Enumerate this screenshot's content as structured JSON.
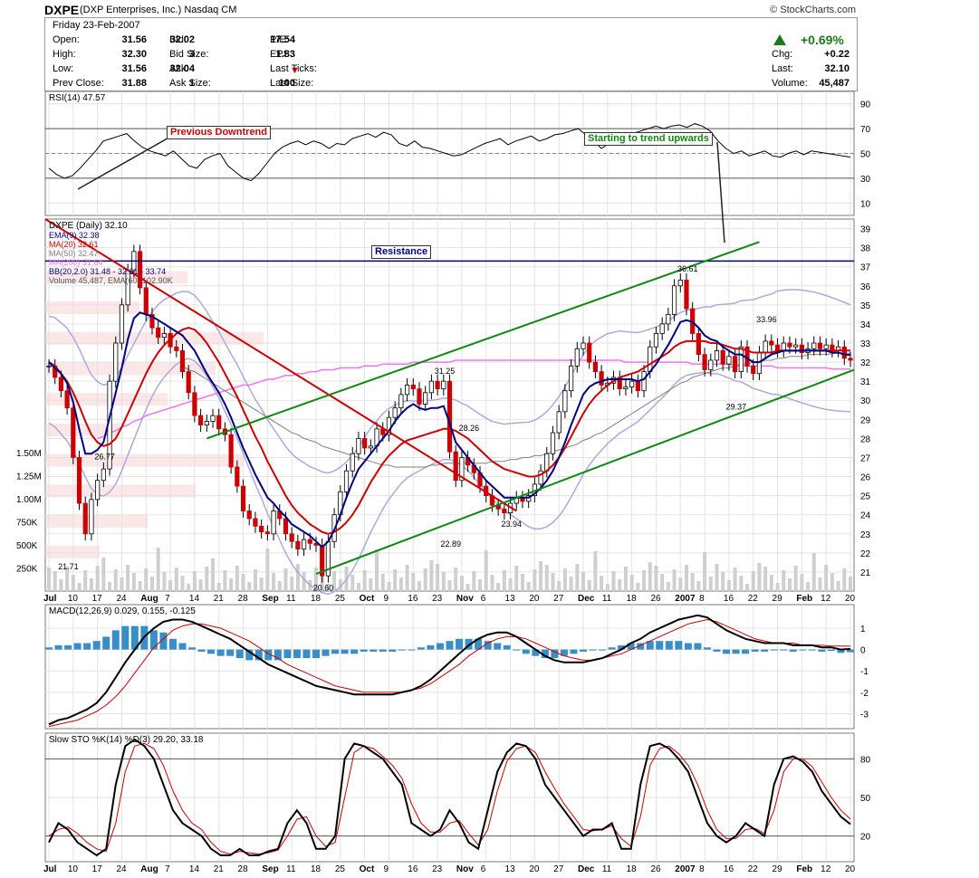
{
  "header": {
    "symbol": "DXPE",
    "company": "(DXP Enterprises, Inc.)  Nasdaq CM",
    "source": "© StockCharts.com"
  },
  "quote": {
    "date": "Friday   23-Feb-2007",
    "rows": [
      [
        "Open:",
        "31.56",
        "Bid:",
        "32.02",
        "P/E:",
        "17.54"
      ],
      [
        "High:",
        "32.30",
        "Bid Size:",
        "3",
        "EPS:",
        "1.83"
      ],
      [
        "Low:",
        "31.56",
        "Ask:",
        "32.04",
        "Last Ticks:",
        ""
      ],
      [
        "Prev Close:",
        "31.88",
        "Ask Size:",
        "1",
        "Last Size:",
        "100"
      ]
    ],
    "pct": "+0.69%",
    "right": [
      [
        "Chg:",
        "+0.22"
      ],
      [
        "Last:",
        "32.10"
      ],
      [
        "Volume:",
        "45,487"
      ]
    ]
  },
  "annotations": {
    "prev_down": "Previous Downtrend",
    "trend_up": "Starting to trend upwards",
    "resistance": "Resistance"
  },
  "colors": {
    "up": "#ffffff",
    "down": "#cc0000",
    "ema9": "#000080",
    "ma20": "#cc0000",
    "ma50": "#808080",
    "ma200": "#ee77ee",
    "bb": "#aaaadd",
    "green": "#118811",
    "resistance": "#000080",
    "volume": "#cfcfcf",
    "macd_hist": "#3a8ec8"
  },
  "chart_data": [
    {
      "type": "line",
      "title": "RSI(14) 47.57",
      "ylim": [
        0,
        100
      ],
      "yticks": [
        10,
        30,
        50,
        70,
        90
      ],
      "series": [
        {
          "values": [
            38,
            33,
            30,
            32,
            38,
            45,
            52,
            60,
            62,
            64,
            66,
            60,
            55,
            52,
            50,
            48,
            52,
            46,
            40,
            38,
            45,
            48,
            50,
            40,
            35,
            30,
            28,
            34,
            42,
            50,
            55,
            58,
            60,
            57,
            60,
            58,
            54,
            58,
            57,
            62,
            64,
            66,
            63,
            67,
            65,
            58,
            56,
            60,
            55,
            54,
            52,
            50,
            48,
            49,
            52,
            55,
            58,
            60,
            62,
            57,
            60,
            62,
            64,
            60,
            62,
            65,
            66,
            68,
            70,
            65,
            60,
            54,
            58,
            62,
            63,
            66,
            68,
            70,
            72,
            70,
            72,
            73,
            71,
            74,
            72,
            68,
            60,
            54,
            50,
            52,
            48,
            50,
            52,
            48,
            47,
            50,
            52,
            49,
            52,
            51,
            50,
            49,
            48,
            47
          ]
        }
      ]
    },
    {
      "type": "candlestick",
      "title": "DXPE (Daily) 32.10",
      "legend": [
        "EMA(9) 32.38",
        "MA(20) 32.61",
        "MA(50) 32.47",
        "MA(200) 31.64",
        "BB(20,2.0) 31.48 - 32.61 - 33.74",
        "Volume 45,487, EMA(60) 102.90K"
      ],
      "ylim": [
        20,
        39.5
      ],
      "yticks": [
        21,
        22,
        23,
        24,
        25,
        26,
        27,
        28,
        29,
        30,
        31,
        32,
        33,
        34,
        35,
        36,
        37,
        38,
        39
      ],
      "x_ticks": [
        "Jul",
        "10",
        "17",
        "24",
        "Aug",
        "7",
        "14",
        "21",
        "28",
        "Sep",
        "11",
        "18",
        "25",
        "Oct",
        "9",
        "16",
        "23",
        "Nov",
        "6",
        "13",
        "20",
        "27",
        "Dec",
        "11",
        "18",
        "26",
        "2007",
        "8",
        "16",
        "22",
        "29",
        "Feb",
        "12",
        "20"
      ],
      "resistance": 37.3,
      "volume_ticks": [
        "250K",
        "500K",
        "750K",
        "1.00M",
        "1.25M",
        "1.50M"
      ],
      "labels": [
        {
          "idx": 3,
          "v": 21.71,
          "text": "21.71"
        },
        {
          "idx": 9,
          "v": 26.77,
          "text": "26.77"
        },
        {
          "idx": 45,
          "v": 20.6,
          "text": "20.60"
        },
        {
          "idx": 65,
          "v": 31.25,
          "text": "31.25"
        },
        {
          "idx": 66,
          "v": 22.89,
          "text": "22.89"
        },
        {
          "idx": 69,
          "v": 28.26,
          "text": "28.26"
        },
        {
          "idx": 76,
          "v": 23.94,
          "text": "23.94"
        },
        {
          "idx": 105,
          "v": 36.61,
          "text": "36.61"
        },
        {
          "idx": 113,
          "v": 29.37,
          "text": "29.37"
        },
        {
          "idx": 118,
          "v": 33.96,
          "text": "33.96"
        }
      ],
      "close": [
        31.8,
        31.2,
        30.5,
        29.6,
        27.0,
        24.6,
        23.0,
        24.8,
        25.8,
        26.4,
        31.0,
        33.0,
        35.0,
        36.8,
        37.8,
        35.9,
        34.5,
        33.8,
        33.3,
        33.5,
        32.8,
        32.6,
        31.5,
        30.4,
        29.2,
        28.7,
        28.9,
        29.2,
        28.5,
        28.2,
        26.5,
        25.5,
        24.2,
        23.8,
        23.4,
        23.1,
        23.0,
        24.2,
        23.8,
        23.0,
        22.6,
        22.2,
        22.7,
        22.5,
        22.4,
        20.8,
        22.6,
        24.0,
        25.2,
        26.3,
        27.2,
        28.0,
        27.5,
        27.6,
        28.5,
        28.2,
        29.1,
        29.6,
        30.3,
        30.8,
        30.6,
        29.8,
        30.4,
        31.0,
        30.6,
        31.0,
        27.3,
        25.8,
        27.0,
        26.6,
        26.2,
        25.5,
        25.0,
        24.5,
        24.3,
        24.1,
        24.6,
        24.9,
        24.7,
        25.0,
        25.6,
        26.3,
        27.2,
        28.3,
        29.4,
        30.5,
        31.8,
        32.7,
        33.0,
        32.0,
        31.5,
        30.8,
        30.9,
        31.2,
        30.6,
        30.7,
        31.0,
        30.5,
        31.5,
        32.8,
        33.5,
        34.0,
        34.5,
        36.0,
        36.3,
        34.8,
        33.5,
        32.4,
        31.6,
        32.1,
        32.6,
        31.9,
        32.3,
        31.5,
        32.8,
        31.8,
        31.4,
        32.5,
        33.1,
        32.9,
        32.6,
        33.0,
        32.8,
        32.9,
        32.5,
        32.7,
        33.0,
        32.7,
        32.9,
        32.6,
        32.8,
        32.2,
        32.1
      ],
      "ema9": [
        32,
        31.7,
        31.4,
        30.9,
        29.9,
        28.5,
        27.2,
        27.2,
        27.4,
        27.8,
        29.1,
        30.4,
        31.7,
        33.2,
        34.3,
        34.6,
        34.5,
        34.4,
        34.2,
        34.0,
        33.8,
        33.6,
        33.4,
        33.0,
        32.6,
        32.0,
        31.4,
        30.9,
        30.4,
        29.8,
        29.1,
        28.3,
        27.5,
        26.8,
        26.1,
        25.5,
        24.9,
        24.6,
        24.2,
        23.9,
        23.5,
        23.3,
        23.1,
        22.9,
        22.6,
        22.3,
        22.6,
        23.2,
        24.0,
        24.9,
        25.7,
        26.4,
        26.8,
        27.2,
        27.6,
        28.0,
        28.4,
        28.9,
        29.3,
        29.6,
        29.8,
        29.6,
        29.5,
        29.6,
        29.6,
        29.7,
        28.8,
        27.8,
        27.4,
        27.0,
        26.6,
        26.2,
        25.8,
        25.5,
        25.2,
        24.9,
        24.9,
        24.9,
        24.9,
        24.9,
        25.1,
        25.4,
        25.8,
        26.3,
        27.0,
        27.8,
        28.7,
        29.5,
        30.3,
        30.7,
        30.9,
        31.0,
        31.1,
        31.1,
        31.1,
        31.1,
        31.1,
        31.0,
        31.1,
        31.5,
        31.9,
        32.4,
        32.9,
        33.5,
        34.1,
        34.2,
        34.1,
        33.8,
        33.4,
        33.2,
        33.1,
        32.8,
        32.6,
        32.4,
        32.4,
        32.2,
        32.0,
        32.0,
        32.2,
        32.4,
        32.5,
        32.6,
        32.6,
        32.6,
        32.6,
        32.6,
        32.6,
        32.6,
        32.6,
        32.5,
        32.5,
        32.4,
        32.38
      ],
      "ma20": [
        32,
        31.8,
        31.4,
        31.0,
        30.4,
        29.7,
        28.9,
        28.2,
        27.8,
        27.6,
        27.7,
        28.0,
        28.6,
        29.3,
        30.0,
        30.7,
        31.4,
        32.0,
        32.5,
        32.9,
        33.2,
        33.5,
        33.7,
        33.8,
        33.7,
        33.4,
        33.0,
        32.5,
        32.0,
        31.4,
        30.8,
        30.2,
        29.5,
        28.8,
        28.1,
        27.5,
        26.8,
        26.2,
        25.6,
        25.0,
        24.5,
        24.1,
        23.8,
        23.5,
        23.3,
        23.1,
        23.0,
        23.1,
        23.3,
        23.6,
        24.0,
        24.5,
        25.1,
        25.7,
        26.2,
        26.7,
        27.1,
        27.4,
        27.7,
        27.9,
        28.0,
        28.1,
        28.2,
        28.3,
        28.4,
        28.5,
        28.5,
        28.4,
        28.2,
        28.0,
        27.7,
        27.4,
        27.1,
        26.8,
        26.6,
        26.4,
        26.3,
        26.2,
        26.1,
        26.0,
        26.0,
        26.1,
        26.3,
        26.6,
        27.0,
        27.5,
        28.1,
        28.7,
        29.3,
        29.8,
        30.2,
        30.5,
        30.8,
        31.0,
        31.2,
        31.3,
        31.4,
        31.5,
        31.7,
        31.9,
        32.1,
        32.3,
        32.5,
        32.8,
        33.0,
        33.1,
        33.1,
        33.1,
        33.1,
        33.0,
        33.0,
        32.9,
        32.8,
        32.7,
        32.7,
        32.6,
        32.5,
        32.5,
        32.5,
        32.5,
        32.6,
        32.6,
        32.6,
        32.6,
        32.6,
        32.6,
        32.6,
        32.6,
        32.6,
        32.6,
        32.61,
        32.61,
        32.61
      ],
      "ma50": [
        null,
        null,
        null,
        null,
        null,
        null,
        null,
        null,
        null,
        null,
        null,
        null,
        null,
        null,
        null,
        null,
        null,
        null,
        null,
        null,
        null,
        null,
        31.8,
        31.6,
        31.5,
        31.3,
        31.1,
        30.9,
        30.7,
        30.5,
        30.3,
        30.1,
        29.9,
        29.7,
        29.5,
        29.3,
        29.1,
        28.9,
        28.7,
        28.5,
        28.3,
        28.2,
        28.0,
        27.9,
        27.8,
        27.6,
        27.5,
        27.4,
        27.3,
        27.2,
        27.1,
        27.0,
        26.9,
        26.8,
        26.7,
        26.6,
        26.6,
        26.5,
        26.5,
        26.5,
        26.5,
        26.5,
        26.5,
        26.6,
        26.6,
        26.7,
        26.7,
        26.7,
        26.7,
        26.7,
        26.7,
        26.7,
        26.7,
        26.8,
        26.8,
        26.8,
        26.9,
        26.9,
        27.0,
        27.0,
        27.1,
        27.1,
        27.2,
        27.3,
        27.4,
        27.5,
        27.6,
        27.7,
        27.9,
        28.0,
        28.2,
        28.3,
        28.5,
        28.7,
        28.9,
        29.1,
        29.3,
        29.5,
        29.7,
        29.9,
        30.1,
        30.3,
        30.5,
        30.7,
        30.9,
        31.0,
        31.2,
        31.3,
        31.4,
        31.5,
        31.6,
        31.7,
        31.7,
        31.8,
        31.9,
        31.9,
        32.0,
        32.0,
        32.1,
        32.1,
        32.2,
        32.2,
        32.3,
        32.3,
        32.3,
        32.4,
        32.4,
        32.4,
        32.4,
        32.45,
        32.46,
        32.47,
        32.47
      ],
      "ma200": [
        null,
        null,
        null,
        null,
        null,
        null,
        null,
        null,
        28.0,
        28.1,
        28.3,
        28.4,
        28.6,
        28.7,
        28.9,
        29.0,
        29.2,
        29.3,
        29.4,
        29.5,
        29.6,
        29.7,
        29.8,
        29.9,
        30.0,
        30.1,
        30.2,
        30.3,
        30.4,
        30.5,
        30.6,
        30.7,
        30.8,
        30.8,
        30.9,
        31.0,
        31.1,
        31.1,
        31.2,
        31.3,
        31.3,
        31.4,
        31.4,
        31.5,
        31.5,
        31.6,
        31.6,
        31.6,
        31.7,
        31.7,
        31.7,
        31.7,
        31.8,
        31.8,
        31.8,
        31.9,
        31.9,
        31.9,
        31.9,
        31.9,
        32.0,
        32.0,
        32.0,
        32.0,
        32.0,
        32.0,
        32.0,
        32.1,
        32.1,
        32.1,
        32.1,
        32.1,
        32.1,
        32.1,
        32.1,
        32.1,
        32.1,
        32.1,
        32.1,
        32.1,
        32.1,
        32.1,
        32.1,
        32.1,
        32.1,
        32.1,
        32.1,
        32.1,
        32.1,
        32.1,
        32.1,
        32.1,
        32.1,
        32.1,
        32.1,
        32.0,
        32.0,
        32.0,
        32.0,
        32.0,
        32.0,
        32.0,
        32.0,
        32.0,
        32.0,
        32.0,
        31.9,
        31.9,
        31.9,
        31.9,
        31.9,
        31.9,
        31.9,
        31.8,
        31.8,
        31.8,
        31.8,
        31.8,
        31.8,
        31.8,
        31.7,
        31.7,
        31.7,
        31.7,
        31.7,
        31.7,
        31.7,
        31.7,
        31.7,
        31.64,
        31.64,
        31.64,
        31.64
      ]
    },
    {
      "type": "bar+line",
      "title": "MACD(12,26,9) 0.029, 0.155, -0.125",
      "ylim": [
        -3.7,
        2.1
      ],
      "yticks": [
        -3,
        -2,
        -1,
        0,
        1
      ],
      "macd": [
        -3.5,
        -3.3,
        -3.2,
        -3.0,
        -2.8,
        -2.5,
        -2.0,
        -1.3,
        -0.6,
        0,
        0.6,
        1.0,
        1.3,
        1.4,
        1.4,
        1.3,
        1.1,
        0.9,
        0.7,
        0.5,
        0.2,
        -0.1,
        -0.4,
        -0.7,
        -0.9,
        -1.1,
        -1.3,
        -1.5,
        -1.7,
        -1.8,
        -1.9,
        -2.0,
        -2.1,
        -2.1,
        -2.1,
        -2.1,
        -2.1,
        -2.0,
        -1.9,
        -1.7,
        -1.4,
        -1.0,
        -0.6,
        -0.2,
        0.2,
        0.5,
        0.7,
        0.8,
        0.8,
        0.6,
        0.3,
        0.0,
        -0.3,
        -0.5,
        -0.6,
        -0.6,
        -0.6,
        -0.5,
        -0.4,
        -0.2,
        0.0,
        0.3,
        0.5,
        0.8,
        1.0,
        1.2,
        1.4,
        1.5,
        1.6,
        1.5,
        1.2,
        0.9,
        0.7,
        0.5,
        0.4,
        0.3,
        0.3,
        0.3,
        0.2,
        0.2,
        0.2,
        0.1,
        0.1,
        0.0,
        0.03
      ],
      "signal": [
        -3.6,
        -3.5,
        -3.4,
        -3.3,
        -3.1,
        -2.9,
        -2.6,
        -2.2,
        -1.7,
        -1.1,
        -0.5,
        0.1,
        0.5,
        0.9,
        1.1,
        1.2,
        1.2,
        1.1,
        1.0,
        0.8,
        0.6,
        0.4,
        0.1,
        -0.2,
        -0.4,
        -0.7,
        -0.9,
        -1.1,
        -1.3,
        -1.5,
        -1.7,
        -1.8,
        -1.9,
        -2.0,
        -2.0,
        -2.0,
        -2.0,
        -2.0,
        -1.9,
        -1.8,
        -1.6,
        -1.3,
        -1.0,
        -0.7,
        -0.3,
        0.0,
        0.3,
        0.5,
        0.6,
        0.6,
        0.5,
        0.3,
        0.1,
        -0.1,
        -0.3,
        -0.4,
        -0.5,
        -0.5,
        -0.4,
        -0.3,
        -0.2,
        0.0,
        0.2,
        0.4,
        0.6,
        0.8,
        1.0,
        1.2,
        1.3,
        1.4,
        1.3,
        1.1,
        0.9,
        0.7,
        0.5,
        0.4,
        0.3,
        0.3,
        0.3,
        0.2,
        0.2,
        0.2,
        0.16,
        0.16,
        0.155
      ]
    },
    {
      "type": "line",
      "title": "Slow STO %K(14) %D(3) 29.20, 33.18",
      "ylim": [
        0,
        100
      ],
      "yticks": [
        20,
        50,
        80
      ],
      "k": [
        15,
        30,
        25,
        15,
        10,
        5,
        10,
        60,
        90,
        95,
        90,
        80,
        60,
        40,
        30,
        25,
        20,
        10,
        5,
        5,
        10,
        5,
        5,
        8,
        10,
        30,
        40,
        30,
        10,
        10,
        20,
        80,
        92,
        90,
        85,
        80,
        70,
        60,
        30,
        25,
        20,
        25,
        40,
        30,
        15,
        10,
        40,
        70,
        85,
        92,
        90,
        80,
        60,
        50,
        40,
        30,
        20,
        25,
        25,
        30,
        10,
        10,
        60,
        90,
        92,
        88,
        80,
        70,
        50,
        30,
        20,
        15,
        20,
        30,
        25,
        20,
        60,
        80,
        82,
        78,
        70,
        55,
        45,
        35,
        29.2
      ],
      "d": [
        20,
        25,
        27,
        22,
        15,
        10,
        8,
        30,
        70,
        90,
        92,
        88,
        75,
        55,
        40,
        30,
        25,
        15,
        8,
        6,
        8,
        7,
        6,
        7,
        9,
        20,
        33,
        35,
        20,
        12,
        15,
        50,
        85,
        90,
        88,
        82,
        75,
        65,
        45,
        30,
        23,
        23,
        30,
        32,
        22,
        13,
        25,
        55,
        78,
        88,
        90,
        85,
        70,
        57,
        45,
        35,
        25,
        24,
        25,
        28,
        18,
        12,
        35,
        75,
        88,
        90,
        84,
        75,
        60,
        40,
        25,
        18,
        18,
        25,
        26,
        22,
        40,
        70,
        80,
        80,
        74,
        62,
        50,
        40,
        33.18
      ]
    }
  ]
}
